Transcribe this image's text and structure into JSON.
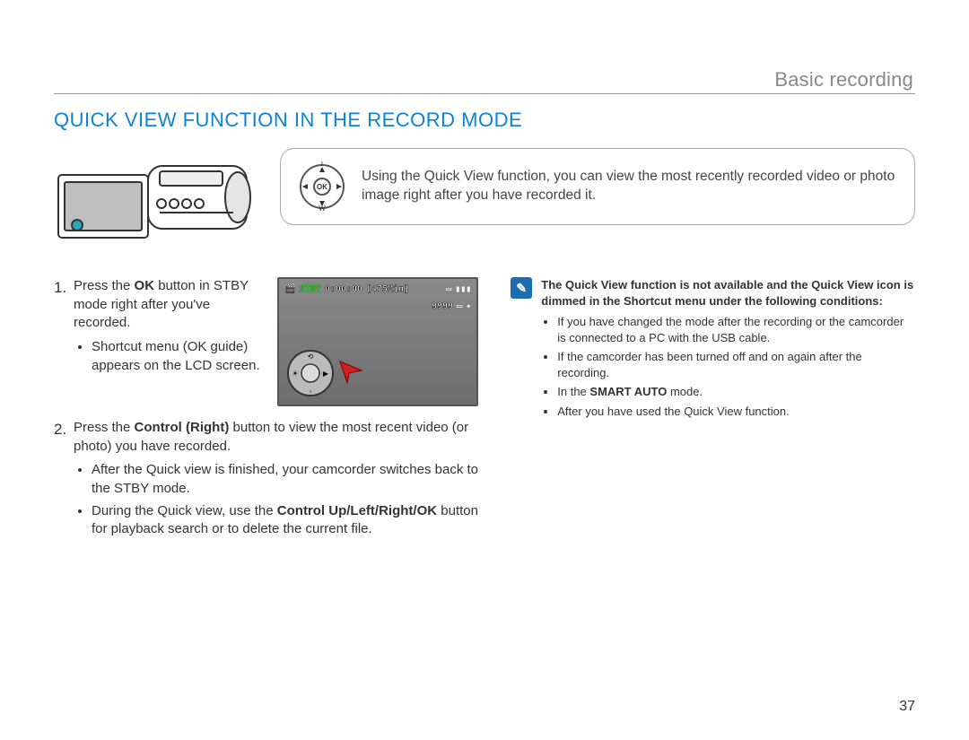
{
  "breadcrumb": "Basic recording",
  "section_title": "QUICK VIEW FUNCTION IN THE RECORD MODE",
  "callout": {
    "dial": {
      "t": "T",
      "w": "W",
      "ok": "OK"
    },
    "text": "Using the Quick View function, you can view the most recently recorded video or photo image right after you have recorded it."
  },
  "lcd": {
    "stby": "STBY",
    "timecode": "0:00:00",
    "remain": "[475Min]",
    "count": "9999"
  },
  "steps": [
    {
      "prefix": "Press the ",
      "bold": "OK",
      "suffix": " button in STBY mode right after you've recorded.",
      "sub": [
        "Shortcut menu (OK guide) appears on the LCD screen."
      ]
    },
    {
      "prefix": "Press the ",
      "bold": "Control (Right)",
      "suffix": " button to view the most recent video (or photo) you have recorded.",
      "sub": [
        "After the Quick view is finished, your camcorder switches back to the STBY mode.",
        {
          "pre": "During the Quick view, use the ",
          "bold": "Control Up/Left/Right/OK",
          "post": " button for playback search or to delete the current file."
        }
      ]
    }
  ],
  "note": {
    "head": "The Quick View function is not available and the Quick View icon is dimmed in the Shortcut menu under the following conditions:",
    "items": [
      "If you have changed the mode after the recording or the camcorder is connected to a PC with the USB cable.",
      "If the camcorder has been turned off and on again after the recording.",
      {
        "pre": "In the ",
        "bold": "SMART AUTO",
        "post": " mode."
      },
      "After you have used the Quick View function."
    ]
  },
  "page_number": "37"
}
